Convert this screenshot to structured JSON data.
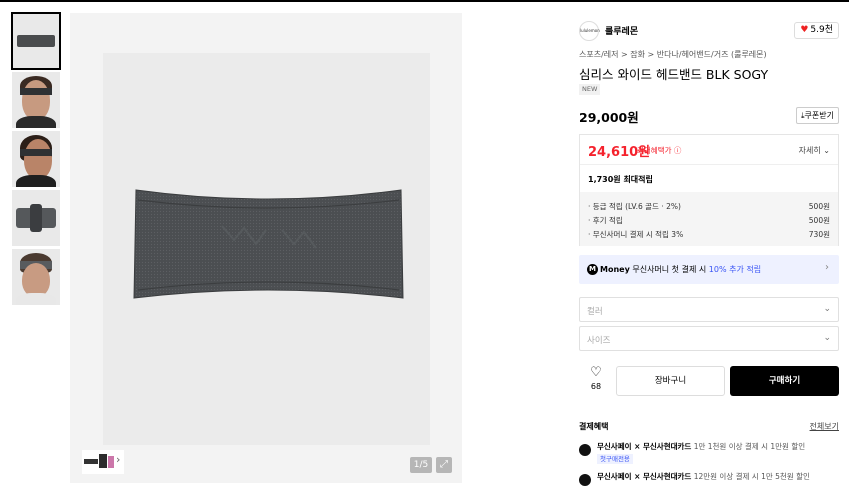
{
  "brand": {
    "logo_text": "lululemon",
    "name": "룰루레몬",
    "likes": "5.9천"
  },
  "breadcrumb": "스포츠/레저 > 잡화 > 반다나/헤어밴드/거즈 (룰루레몬)",
  "product": {
    "title": "심리스 와이드 헤드밴드 BLK SOGY",
    "tag": "NEW",
    "price": "29,000원"
  },
  "coupon_label": "쿠폰받기",
  "benefit": {
    "sale_price": "24,610원",
    "sale_label": "최대혜택가",
    "detail_label": "자세히",
    "points_total": "1,730원 최대적립",
    "points": [
      {
        "label": "· 등급 적립 (LV.6 골드 · 2%)",
        "value": "500원"
      },
      {
        "label": "· 후기 적립",
        "value": "500원"
      },
      {
        "label": "· 무신사머니 결제 시 적립 3%",
        "value": "730원"
      }
    ]
  },
  "money_banner": {
    "logo": "M",
    "brand": "Money",
    "text": "무신사머니 첫 결제 시",
    "highlight": "10% 추가 적립"
  },
  "options": {
    "color_placeholder": "컬러",
    "size_placeholder": "사이즈"
  },
  "actions": {
    "like_count": "68",
    "cart_label": "장바구니",
    "buy_label": "구매하기"
  },
  "payment": {
    "title": "결제혜택",
    "all_label": "전체보기",
    "rows": [
      {
        "card": "무신사페이 × 무신사현대카드",
        "desc": "1만 1천원 이상 결제 시 1만원 할인",
        "tag": "첫구매전용"
      },
      {
        "card": "무신사페이 × 무신사현대카드",
        "desc": "12만원 이상 결제 시 1만 5천원 할인"
      }
    ]
  },
  "gallery": {
    "counter": "1/5",
    "thumbnail_count": 5
  }
}
